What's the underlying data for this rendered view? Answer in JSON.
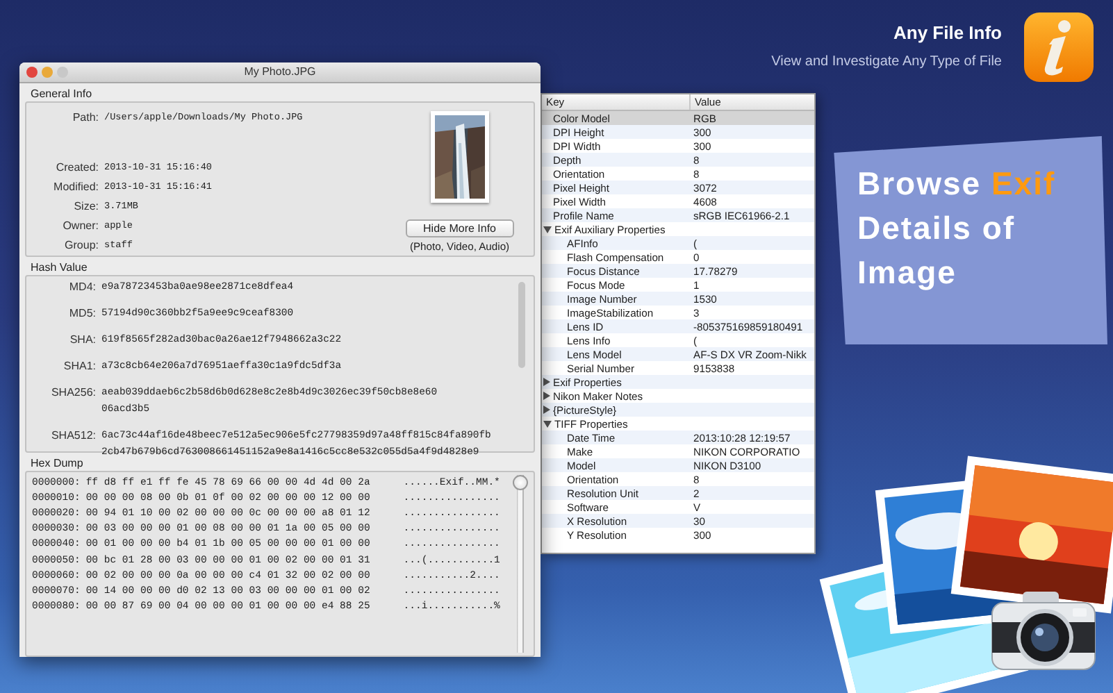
{
  "brand": {
    "name": "Any File Info",
    "tagline": "View and Investigate Any Type of File"
  },
  "callout": {
    "text": "Browse **Exif** Details of Image"
  },
  "window": {
    "title": "My Photo.JPG",
    "general_info": {
      "title": "General Info",
      "fields": [
        {
          "label": "Path:",
          "value": "/Users/apple/Downloads/My Photo.JPG"
        },
        {
          "label": "Created:",
          "value": "2013-10-31 15:16:40"
        },
        {
          "label": "Modified:",
          "value": "2013-10-31 15:16:41"
        },
        {
          "label": "Size:",
          "value": "3.71MB"
        },
        {
          "label": "Owner:",
          "value": "apple"
        },
        {
          "label": "Group:",
          "value": "staff"
        }
      ],
      "button": "Hide More Info",
      "caption": "(Photo, Video, Audio)"
    },
    "hash_value": {
      "title": "Hash Value",
      "fields": [
        {
          "label": "MD4:",
          "lines": [
            "e9a78723453ba0ae98ee2871ce8dfea4"
          ]
        },
        {
          "label": "MD5:",
          "lines": [
            "57194d90c360bb2f5a9ee9c9ceaf8300"
          ]
        },
        {
          "label": "SHA:",
          "lines": [
            "619f8565f282ad30bac0a26ae12f7948662a3c22"
          ]
        },
        {
          "label": "SHA1:",
          "lines": [
            "a73c8cb64e206a7d76951aeffa30c1a9fdc5df3a"
          ]
        },
        {
          "label": "SHA256:",
          "lines": [
            "aeab039ddaeb6c2b58d6b0d628e8c2e8b4d9c3026ec39f50cb8e8e60",
            "06acd3b5"
          ]
        },
        {
          "label": "SHA512:",
          "lines": [
            "6ac73c44af16de48beec7e512a5ec906e5fc27798359d97a48ff815c84fa890fb",
            "2cb47b679b6cd763008661451152a9e8a1416c5cc8e532c055d5a4f9d4828e9"
          ]
        }
      ]
    },
    "hex_dump": {
      "title": "Hex Dump",
      "rows": [
        {
          "offset": "0000000:",
          "hex": "ff d8 ff e1 ff fe 45 78 69 66 00 00 4d 4d 00 2a",
          "ascii": "......Exif..MM.*"
        },
        {
          "offset": "0000010:",
          "hex": "00 00 00 08 00 0b 01 0f 00 02 00 00 00 12 00 00",
          "ascii": "................"
        },
        {
          "offset": "0000020:",
          "hex": "00 94 01 10 00 02 00 00 00 0c 00 00 00 a8 01 12",
          "ascii": "................"
        },
        {
          "offset": "0000030:",
          "hex": "00 03 00 00 00 01 00 08 00 00 01 1a 00 05 00 00",
          "ascii": "................"
        },
        {
          "offset": "0000040:",
          "hex": "00 01 00 00 00 b4 01 1b 00 05 00 00 00 01 00 00",
          "ascii": "................"
        },
        {
          "offset": "0000050:",
          "hex": "00 bc 01 28 00 03 00 00 00 01 00 02 00 00 01 31",
          "ascii": "...(...........1"
        },
        {
          "offset": "0000060:",
          "hex": "00 02 00 00 00 0a 00 00 00 c4 01 32 00 02 00 00",
          "ascii": "...........2...."
        },
        {
          "offset": "0000070:",
          "hex": "00 14 00 00 00 d0 02 13 00 03 00 00 00 01 00 02",
          "ascii": "................"
        },
        {
          "offset": "0000080:",
          "hex": "00 00 87 69 00 04 00 00 00 01 00 00 00 e4 88 25",
          "ascii": "...i...........%"
        }
      ]
    }
  },
  "properties": {
    "columns": [
      "Key",
      "Value"
    ],
    "rows": [
      {
        "kind": "item",
        "key": "Color Model",
        "value": "RGB",
        "selected": true
      },
      {
        "kind": "item",
        "key": "DPI Height",
        "value": "300",
        "selected": false
      },
      {
        "kind": "item",
        "key": "DPI Width",
        "value": "300",
        "selected": false
      },
      {
        "kind": "item",
        "key": "Depth",
        "value": "8",
        "selected": false
      },
      {
        "kind": "item",
        "key": "Orientation",
        "value": "8",
        "selected": false
      },
      {
        "kind": "item",
        "key": "Pixel Height",
        "value": "3072",
        "selected": false
      },
      {
        "kind": "item",
        "key": "Pixel Width",
        "value": "4608",
        "selected": false
      },
      {
        "kind": "item",
        "key": "Profile Name",
        "value": "sRGB IEC61966-2.1",
        "selected": false
      },
      {
        "kind": "group",
        "key": "Exif Auxiliary Properties",
        "expanded": true,
        "selected": false,
        "children": [
          {
            "kind": "item",
            "key": "AFInfo",
            "value": "(",
            "selected": false
          },
          {
            "kind": "item",
            "key": "Flash Compensation",
            "value": "0",
            "selected": false
          },
          {
            "kind": "item",
            "key": "Focus Distance",
            "value": "17.78279",
            "selected": false
          },
          {
            "kind": "item",
            "key": "Focus Mode",
            "value": "1",
            "selected": false
          },
          {
            "kind": "item",
            "key": "Image Number",
            "value": "1530",
            "selected": false
          },
          {
            "kind": "item",
            "key": "ImageStabilization",
            "value": "3",
            "selected": false
          },
          {
            "kind": "item",
            "key": "Lens ID",
            "value": "-805375169859180491",
            "selected": false
          },
          {
            "kind": "item",
            "key": "Lens Info",
            "value": "(",
            "selected": false
          },
          {
            "kind": "item",
            "key": "Lens Model",
            "value": "AF-S DX VR Zoom-Nikk",
            "selected": false
          },
          {
            "kind": "item",
            "key": "Serial Number",
            "value": "9153838",
            "selected": false
          }
        ]
      },
      {
        "kind": "group",
        "key": "Exif Properties",
        "expanded": false,
        "selected": false
      },
      {
        "kind": "group",
        "key": "Nikon Maker Notes",
        "expanded": false,
        "selected": false
      },
      {
        "kind": "group",
        "key": "{PictureStyle}",
        "expanded": false,
        "selected": false
      },
      {
        "kind": "group",
        "key": "TIFF Properties",
        "expanded": true,
        "selected": false,
        "children": [
          {
            "kind": "item",
            "key": "Date Time",
            "value": "2013:10:28 12:19:57",
            "selected": false
          },
          {
            "kind": "item",
            "key": "Make",
            "value": "NIKON CORPORATIO",
            "selected": false
          },
          {
            "kind": "item",
            "key": "Model",
            "value": "NIKON D3100",
            "selected": false
          },
          {
            "kind": "item",
            "key": "Orientation",
            "value": "8",
            "selected": false
          },
          {
            "kind": "item",
            "key": "Resolution Unit",
            "value": "2",
            "selected": false
          },
          {
            "kind": "item",
            "key": "Software",
            "value": "V",
            "selected": false
          },
          {
            "kind": "item",
            "key": "X Resolution",
            "value": "30",
            "selected": false
          },
          {
            "kind": "item",
            "key": "Y Resolution",
            "value": "300",
            "selected": false
          }
        ]
      }
    ]
  }
}
